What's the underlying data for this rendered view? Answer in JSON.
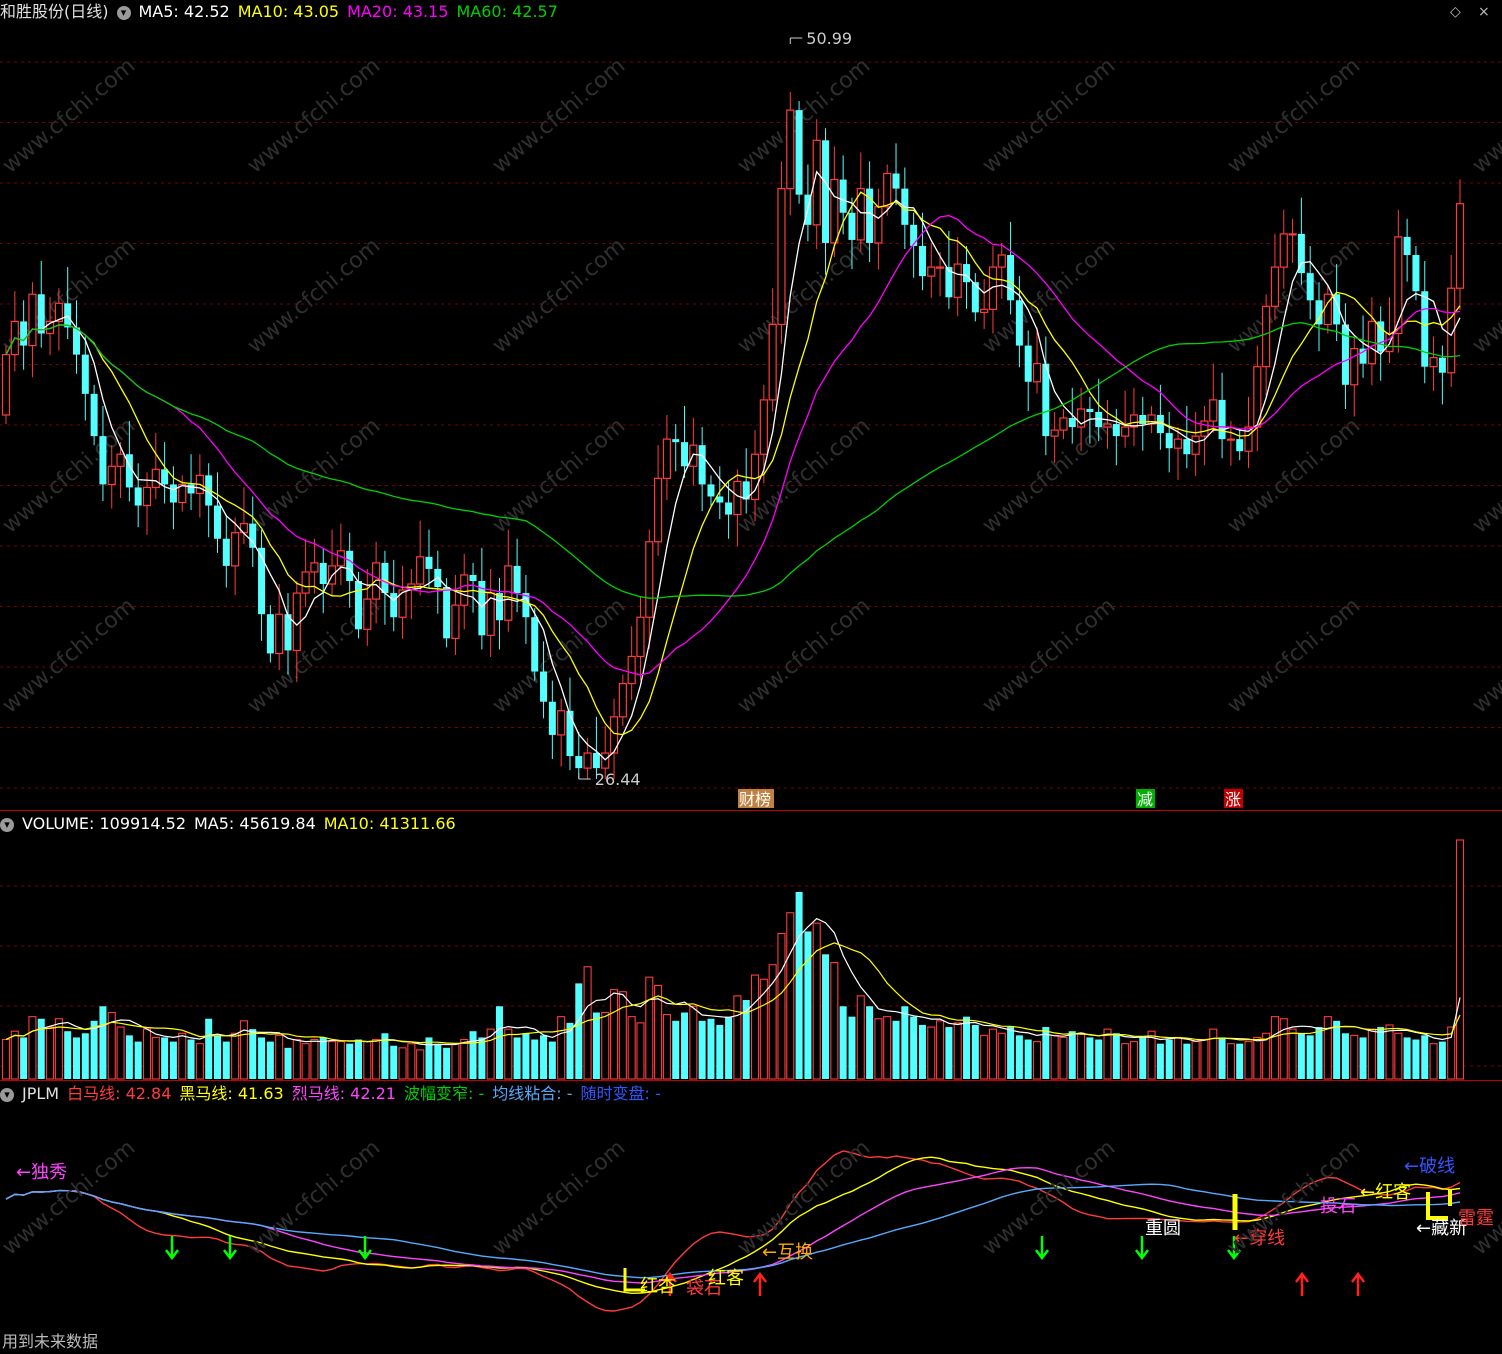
{
  "main_header": {
    "title": "和胜股份(日线)",
    "ma5": "MA5: 42.52",
    "ma10": "MA10: 43.05",
    "ma20": "MA20: 43.15",
    "ma60": "MA60: 42.57"
  },
  "volume_header": {
    "volume": "VOLUME: 109914.52",
    "ma5": "MA5: 45619.84",
    "ma10": "MA10: 41311.66"
  },
  "ind_header": {
    "name": "JPLM",
    "bai": "白马线: 42.84",
    "hei": "黑马线: 41.63",
    "lie": "烈马线: 42.21",
    "bofu": "波幅变窄: -",
    "junxian": "均线粘合: -",
    "suishi": "随时变盘: -"
  },
  "footer": "用到未来数据",
  "watermark": "www.cfchi.com",
  "colors": {
    "up": "#ff3b3b",
    "down": "#54ffff",
    "ma5": "#ffffff",
    "ma10": "#ffff00",
    "ma20": "#ff00ff",
    "ma60": "#00d000",
    "grid": "#7a0000"
  },
  "chart_data": [
    {
      "type": "candlestick",
      "title": "和胜股份(日线)",
      "ylim": [
        26.44,
        50.99
      ],
      "annotations": [
        {
          "text": "50.99",
          "kind": "high"
        },
        {
          "text": "26.44",
          "kind": "low"
        }
      ],
      "event_tags": [
        {
          "text": "财榜",
          "color": "#c08040"
        },
        {
          "text": "减",
          "color": "#00b000"
        },
        {
          "text": "涨",
          "color": "#c00000"
        }
      ],
      "open": [
        38.5,
        40.5,
        41.6,
        40.8,
        42.5,
        41.2,
        41.6,
        42.2,
        41.4,
        40.5,
        39.2,
        37.8,
        36.2,
        36.8,
        37.2,
        36.1,
        35.5,
        36.1,
        36.7,
        36.2,
        35.6,
        36.2,
        35.9,
        36.5,
        35.5,
        34.4,
        33.5,
        34.6,
        34.9,
        34.1,
        31.9,
        30.6,
        31.9,
        30.7,
        32.6,
        33.3,
        33.6,
        32.9,
        33.5,
        34.0,
        33.0,
        31.4,
        32.4,
        33.6,
        32.6,
        31.8,
        32.7,
        32.9,
        33.8,
        33.4,
        32.8,
        31.1,
        32.2,
        33.2,
        33.0,
        31.2,
        32.6,
        31.7,
        33.5,
        32.6,
        31.8,
        30.0,
        29.0,
        27.9,
        28.7,
        27.2,
        26.8,
        27.3,
        26.8,
        27.3,
        28.5,
        29.6,
        30.5,
        31.8,
        34.3,
        36.4,
        37.7,
        37.6,
        36.8,
        37.5,
        36.2,
        35.8,
        35.6,
        35.2,
        36.3,
        35.7,
        37.2,
        39.0,
        41.5,
        46.0,
        48.6,
        45.8,
        44.8,
        47.6,
        44.2,
        46.3,
        45.2,
        44.3,
        46.0,
        44.2,
        45.4,
        46.5,
        46.0,
        44.8,
        44.1,
        43.1,
        43.4,
        43.4,
        42.4,
        43.5,
        42.9,
        41.9,
        42.0,
        43.4,
        43.8,
        42.3,
        40.8,
        39.6,
        40.2,
        37.8,
        38.0,
        38.4,
        38.1,
        38.7,
        38.6,
        38.1,
        38.2,
        37.8,
        38.1,
        38.5,
        38.2,
        38.5,
        37.9,
        37.4,
        37.7,
        37.2,
        37.8,
        38.3,
        39.0,
        37.7,
        37.7,
        37.3,
        38.1,
        40.1,
        42.1,
        43.4,
        44.5,
        44.5,
        43.2,
        42.3,
        41.5,
        42.5,
        41.5,
        39.5,
        40.7,
        40.2,
        41.6,
        40.6,
        41.2,
        44.4,
        43.8,
        42.6,
        40.1,
        40.4,
        39.9,
        42.7
      ],
      "close": [
        40.5,
        41.6,
        40.8,
        42.5,
        41.2,
        41.6,
        42.2,
        41.4,
        40.5,
        39.2,
        37.8,
        36.2,
        36.8,
        37.2,
        36.1,
        35.5,
        36.1,
        36.7,
        36.2,
        35.6,
        36.2,
        35.9,
        36.5,
        35.5,
        34.4,
        33.5,
        34.6,
        34.9,
        34.1,
        31.9,
        30.6,
        31.9,
        30.7,
        32.6,
        33.3,
        33.6,
        32.9,
        33.5,
        34.0,
        33.0,
        31.4,
        32.4,
        33.6,
        32.6,
        31.8,
        32.7,
        32.9,
        33.8,
        33.4,
        32.8,
        31.1,
        32.2,
        33.2,
        33.0,
        31.2,
        32.6,
        31.7,
        33.5,
        32.6,
        31.8,
        30.0,
        29.0,
        27.9,
        28.7,
        27.2,
        26.8,
        27.3,
        26.8,
        27.3,
        28.5,
        29.6,
        30.5,
        31.8,
        34.3,
        36.4,
        37.7,
        37.6,
        36.8,
        37.5,
        36.2,
        35.8,
        35.6,
        35.2,
        36.3,
        35.7,
        37.2,
        39.0,
        41.5,
        46.0,
        48.6,
        45.8,
        44.8,
        47.6,
        44.2,
        46.3,
        45.2,
        44.3,
        46.0,
        44.2,
        45.4,
        46.5,
        46.0,
        44.8,
        44.1,
        43.1,
        43.4,
        43.4,
        42.4,
        43.5,
        42.9,
        41.9,
        42.0,
        43.4,
        43.8,
        42.3,
        40.8,
        39.6,
        40.2,
        37.8,
        38.0,
        38.4,
        38.1,
        38.7,
        38.6,
        38.1,
        38.2,
        37.8,
        38.1,
        38.5,
        38.2,
        38.5,
        37.9,
        37.4,
        37.7,
        37.2,
        37.8,
        38.3,
        39.0,
        37.7,
        37.7,
        37.3,
        38.1,
        40.1,
        42.1,
        43.4,
        44.5,
        44.5,
        43.2,
        42.3,
        41.5,
        42.5,
        41.5,
        39.5,
        40.7,
        40.2,
        41.6,
        40.6,
        41.2,
        44.4,
        43.8,
        42.6,
        40.1,
        40.4,
        39.9,
        42.7,
        45.5
      ],
      "high_low_note": "high = max(open,close)+small tail, low = min(open,close)-small tail; extremes 50.99 / 26.44 as printed",
      "ma_values": {
        "MA5": 42.52,
        "MA10": 43.05,
        "MA20": 43.15,
        "MA60": 42.57
      }
    },
    {
      "type": "bar",
      "title": "VOLUME",
      "values": [
        38,
        46,
        40,
        60,
        58,
        50,
        58,
        46,
        40,
        44,
        56,
        70,
        64,
        50,
        42,
        36,
        48,
        40,
        40,
        36,
        44,
        38,
        34,
        58,
        42,
        36,
        44,
        56,
        48,
        40,
        36,
        42,
        30,
        38,
        34,
        38,
        40,
        36,
        36,
        34,
        38,
        36,
        38,
        44,
        32,
        30,
        34,
        28,
        40,
        34,
        30,
        34,
        38,
        46,
        40,
        48,
        70,
        48,
        40,
        44,
        38,
        42,
        36,
        60,
        54,
        92,
        108,
        64,
        64,
        86,
        84,
        60,
        54,
        98,
        90,
        62,
        56,
        64,
        70,
        56,
        58,
        52,
        60,
        80,
        76,
        100,
        96,
        110,
        140,
        160,
        180,
        142,
        150,
        120,
        112,
        70,
        60,
        80,
        70,
        58,
        60,
        56,
        70,
        60,
        52,
        50,
        56,
        50,
        54,
        60,
        52,
        42,
        48,
        44,
        50,
        42,
        38,
        36,
        50,
        42,
        40,
        46,
        44,
        40,
        38,
        48,
        44,
        34,
        36,
        40,
        46,
        34,
        38,
        40,
        34,
        36,
        38,
        48,
        40,
        34,
        34,
        36,
        40,
        44,
        60,
        58,
        48,
        44,
        42,
        50,
        60,
        56,
        44,
        42,
        40,
        48,
        50,
        52,
        44,
        40,
        38,
        42,
        34,
        36,
        50,
        230
      ],
      "ma5_value": 45619.84,
      "ma10_value": 41311.66,
      "current": 109914.52
    },
    {
      "type": "line",
      "title": "JPLM",
      "series": [
        {
          "name": "白马线",
          "value": 42.84,
          "color": "#ff3b3b"
        },
        {
          "name": "黑马线",
          "value": 41.63,
          "color": "#ffff00"
        },
        {
          "name": "烈马线",
          "value": 42.21,
          "color": "#ff44ff"
        },
        {
          "name": "波幅变窄",
          "value": "-",
          "color": "#00d000"
        },
        {
          "name": "均线粘合",
          "value": "-",
          "color": "#55aaff"
        },
        {
          "name": "随时变盘",
          "value": "-",
          "color": "#3355ff"
        }
      ],
      "labels": [
        {
          "text": "←独秀",
          "color": "#ff44ff"
        },
        {
          "text": "红杏",
          "color": "#ffff00"
        },
        {
          "text": "袋石",
          "color": "#ff3b3b"
        },
        {
          "text": "红客",
          "color": "#ffff00"
        },
        {
          "text": "←互换",
          "color": "#ffaa00"
        },
        {
          "text": "重圆",
          "color": "#ffffff"
        },
        {
          "text": "←穿线",
          "color": "#ff3b3b"
        },
        {
          "text": "投石",
          "color": "#ff44ff"
        },
        {
          "text": "←红客",
          "color": "#ffff00"
        },
        {
          "text": "←破线",
          "color": "#3355ff"
        },
        {
          "text": "←藏新",
          "color": "#ffffff"
        },
        {
          "text": "雷霆",
          "color": "#ff3b3b"
        }
      ]
    }
  ]
}
